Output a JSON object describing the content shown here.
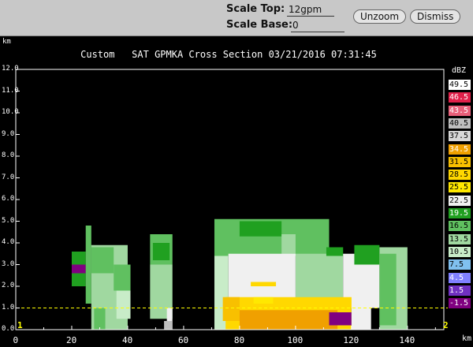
{
  "toolbar": {
    "scale_top_label": "Scale Top:",
    "scale_top_value": "12gpm",
    "scale_base_label": "Scale Base:",
    "scale_base_value": "0",
    "unzoom_label": "Unzoom",
    "dismiss_label": "Dismiss"
  },
  "plot": {
    "title": "Custom   SAT GPMKA Cross Section 03/21/2016 07:31:45",
    "y_unit": "km",
    "x_unit": "km",
    "endpoint_start": "1",
    "endpoint_end": "2",
    "y_ticks": [
      "0.0",
      "1.0",
      "2.0",
      "3.0",
      "4.0",
      "5.0",
      "6.0",
      "7.0",
      "8.0",
      "9.0",
      "10.0",
      "11.0",
      "12.0"
    ],
    "x_ticks": [
      "0",
      "20",
      "40",
      "60",
      "80",
      "100",
      "120",
      "140"
    ],
    "reference_line_km": 1.0,
    "reference_line_color": "#ffff00"
  },
  "legend": {
    "title": "dBZ",
    "items": [
      {
        "label": "49.5",
        "color": "#ffffff"
      },
      {
        "label": "46.5",
        "color": "#e0204a"
      },
      {
        "label": "43.5",
        "color": "#e8607a"
      },
      {
        "label": "40.5",
        "color": "#bfbfbf"
      },
      {
        "label": "37.5",
        "color": "#d8d8d8"
      },
      {
        "label": "34.5",
        "color": "#f0a000"
      },
      {
        "label": "31.5",
        "color": "#f8c000"
      },
      {
        "label": "28.5",
        "color": "#ffd800"
      },
      {
        "label": "25.5",
        "color": "#ffe800"
      },
      {
        "label": "22.5",
        "color": "#f0f0f0"
      },
      {
        "label": "19.5",
        "color": "#20a020"
      },
      {
        "label": "16.5",
        "color": "#60c060"
      },
      {
        "label": "13.5",
        "color": "#a0d8a0"
      },
      {
        "label": "10.5",
        "color": "#c8ecc8"
      },
      {
        "label": "7.5",
        "color": "#80c0f0"
      },
      {
        "label": "4.5",
        "color": "#8080ff"
      },
      {
        "label": "1.5",
        "color": "#7030c0"
      },
      {
        "label": "-1.5",
        "color": "#800080"
      }
    ]
  },
  "chart_data": {
    "type": "heatmap",
    "title": "Custom   SAT GPMKA Cross Section 03/21/2016 07:31:45",
    "xlabel": "km",
    "ylabel": "km",
    "xlim": [
      0,
      153
    ],
    "ylim": [
      0,
      12
    ],
    "colorbar_unit": "dBZ",
    "cells": [
      {
        "x0": 20,
        "x1": 25,
        "y0": 2.0,
        "y1": 3.6,
        "level": "19.5"
      },
      {
        "x0": 20,
        "x1": 25,
        "y0": 2.6,
        "y1": 3.0,
        "level": "-1.5"
      },
      {
        "x0": 25,
        "x1": 27,
        "y0": 1.2,
        "y1": 4.8,
        "level": "16.5"
      },
      {
        "x0": 27,
        "x1": 40,
        "y0": 0.0,
        "y1": 3.9,
        "level": "13.5"
      },
      {
        "x0": 27,
        "x1": 35,
        "y0": 2.6,
        "y1": 3.8,
        "level": "16.5"
      },
      {
        "x0": 35,
        "x1": 41,
        "y0": 1.8,
        "y1": 3.0,
        "level": "16.5"
      },
      {
        "x0": 28,
        "x1": 32,
        "y0": 0.0,
        "y1": 1.0,
        "level": "16.5"
      },
      {
        "x0": 36,
        "x1": 41,
        "y0": 0.5,
        "y1": 1.8,
        "level": "10.5"
      },
      {
        "x0": 48,
        "x1": 56,
        "y0": 3.0,
        "y1": 4.4,
        "level": "16.5"
      },
      {
        "x0": 49,
        "x1": 55,
        "y0": 3.2,
        "y1": 4.0,
        "level": "19.5"
      },
      {
        "x0": 48,
        "x1": 56,
        "y0": 0.5,
        "y1": 3.0,
        "level": "13.5"
      },
      {
        "x0": 54,
        "x1": 56,
        "y0": 0.0,
        "y1": 1.0,
        "level": "22.5"
      },
      {
        "x0": 53,
        "x1": 56,
        "y0": 0.0,
        "y1": 0.4,
        "level": "40.5"
      },
      {
        "x0": 71,
        "x1": 112,
        "y0": 3.4,
        "y1": 5.1,
        "level": "16.5"
      },
      {
        "x0": 80,
        "x1": 95,
        "y0": 4.3,
        "y1": 5.0,
        "level": "19.5"
      },
      {
        "x0": 95,
        "x1": 100,
        "y0": 3.4,
        "y1": 4.4,
        "level": "13.5"
      },
      {
        "x0": 100,
        "x1": 117,
        "y0": 1.0,
        "y1": 3.5,
        "level": "13.5"
      },
      {
        "x0": 76,
        "x1": 100,
        "y0": 1.0,
        "y1": 3.5,
        "level": "22.5"
      },
      {
        "x0": 71,
        "x1": 76,
        "y0": 0.0,
        "y1": 3.4,
        "level": "10.5"
      },
      {
        "x0": 111,
        "x1": 117,
        "y0": 3.4,
        "y1": 3.8,
        "level": "19.5"
      },
      {
        "x0": 117,
        "x1": 130,
        "y0": 1.0,
        "y1": 3.5,
        "level": "22.5"
      },
      {
        "x0": 121,
        "x1": 130,
        "y0": 3.0,
        "y1": 3.9,
        "level": "19.5"
      },
      {
        "x0": 130,
        "x1": 140,
        "y0": 0.0,
        "y1": 3.8,
        "level": "13.5"
      },
      {
        "x0": 130,
        "x1": 136,
        "y0": 0.2,
        "y1": 3.5,
        "level": "16.5"
      },
      {
        "x0": 75,
        "x1": 120,
        "y0": 0.0,
        "y1": 1.5,
        "level": "28.5"
      },
      {
        "x0": 85,
        "x1": 92,
        "y0": 1.2,
        "y1": 1.5,
        "level": "25.5"
      },
      {
        "x0": 74,
        "x1": 80,
        "y0": 0.4,
        "y1": 1.5,
        "level": "31.5"
      },
      {
        "x0": 80,
        "x1": 115,
        "y0": 0.0,
        "y1": 0.9,
        "level": "34.5"
      },
      {
        "x0": 112,
        "x1": 120,
        "y0": 0.2,
        "y1": 0.8,
        "level": "-1.5"
      },
      {
        "x0": 120,
        "x1": 127,
        "y0": 0.0,
        "y1": 1.0,
        "level": "22.5"
      },
      {
        "x0": 84,
        "x1": 93,
        "y0": 2.0,
        "y1": 2.2,
        "level": "28.5"
      }
    ]
  }
}
